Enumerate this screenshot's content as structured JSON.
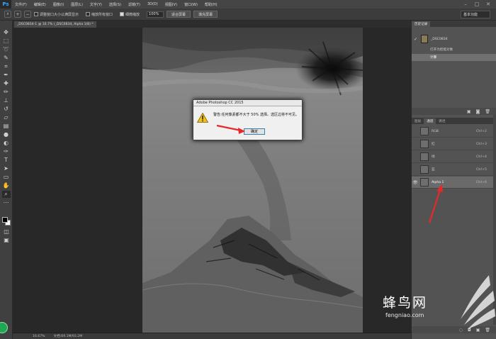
{
  "app": {
    "logo": "Ps"
  },
  "menu": [
    "文件(F)",
    "编辑(E)",
    "图像(I)",
    "图层(L)",
    "文字(Y)",
    "选择(S)",
    "滤镜(T)",
    "3D(D)",
    "视图(V)",
    "窗口(W)",
    "帮助(H)"
  ],
  "options": {
    "resize_windows_label": "调整窗口大小以满屏显示",
    "resize_windows_checked": false,
    "zoom_all_label": "缩放所有窗口",
    "zoom_all_checked": false,
    "scrubby_zoom_label": "细微缩放",
    "scrubby_zoom_checked": true,
    "zoom_value": "100%",
    "fit_screen_label": "适合屏幕",
    "fill_screen_label": "填充屏幕",
    "workspace": "基本功能"
  },
  "document": {
    "tab_title": "_DSC0834-1 @ 16.7% (_DSC0834, Alpha 1/8) *",
    "zoom": "16.67%",
    "doc_info": "文档:69.1M/93.2M"
  },
  "history": {
    "tabs": [
      "历史记录"
    ],
    "snapshot": "_DSC0834",
    "items": [
      {
        "label": "打开为智能对象",
        "selected": false
      },
      {
        "label": "计算",
        "selected": true
      }
    ]
  },
  "channels": {
    "tabs": [
      "图层",
      "通道",
      "路径"
    ],
    "active_tab": "通道",
    "items": [
      {
        "name": "RGB",
        "key": "Ctrl+2",
        "visible": false
      },
      {
        "name": "红",
        "key": "Ctrl+3",
        "visible": false
      },
      {
        "name": "绿",
        "key": "Ctrl+4",
        "visible": false
      },
      {
        "name": "蓝",
        "key": "Ctrl+5",
        "visible": false
      },
      {
        "name": "Alpha 1",
        "key": "Ctrl+6",
        "visible": true
      }
    ]
  },
  "dialog": {
    "title": "Adobe Photoshop CC 2015",
    "message": "警告:任何像素都不大于 50% 选择。选区边将不可见。",
    "ok_label": "确定"
  },
  "watermark": {
    "name": "蜂鸟网",
    "url": "fengniao.com"
  },
  "colors": {
    "arrow": "#e8282b",
    "dialog_border": "#3c7fb1",
    "photoshop_blue": "#31a8ff"
  }
}
